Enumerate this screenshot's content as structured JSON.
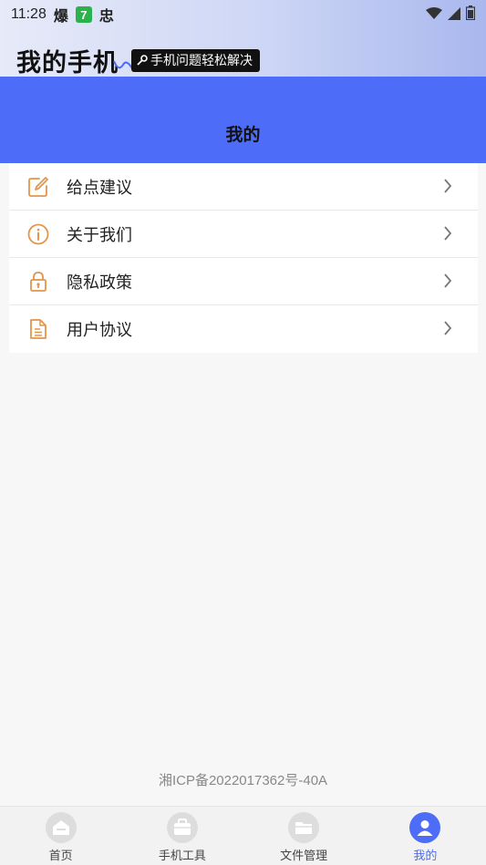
{
  "status_bar": {
    "time": "11:28",
    "glyph_1": "爆",
    "badge": "7",
    "glyph_2": "忠"
  },
  "app": {
    "logo_text": "我的手机",
    "slogan": "手机问题轻松解决"
  },
  "header": {
    "title": "我的"
  },
  "menu": {
    "items": [
      {
        "label": "给点建议",
        "icon": "edit-icon"
      },
      {
        "label": "关于我们",
        "icon": "info-icon"
      },
      {
        "label": "隐私政策",
        "icon": "lock-icon"
      },
      {
        "label": "用户协议",
        "icon": "document-icon"
      }
    ]
  },
  "footer": {
    "icp": "湘ICP备2022017362号-40A"
  },
  "tab_bar": {
    "tabs": [
      {
        "label": "首页",
        "icon": "home-icon"
      },
      {
        "label": "手机工具",
        "icon": "toolbox-icon"
      },
      {
        "label": "文件管理",
        "icon": "folder-icon"
      },
      {
        "label": "我的",
        "icon": "user-icon",
        "active": true
      }
    ]
  },
  "colors": {
    "accent": "#4d6cf7",
    "icon_orange": "#e3964a"
  }
}
